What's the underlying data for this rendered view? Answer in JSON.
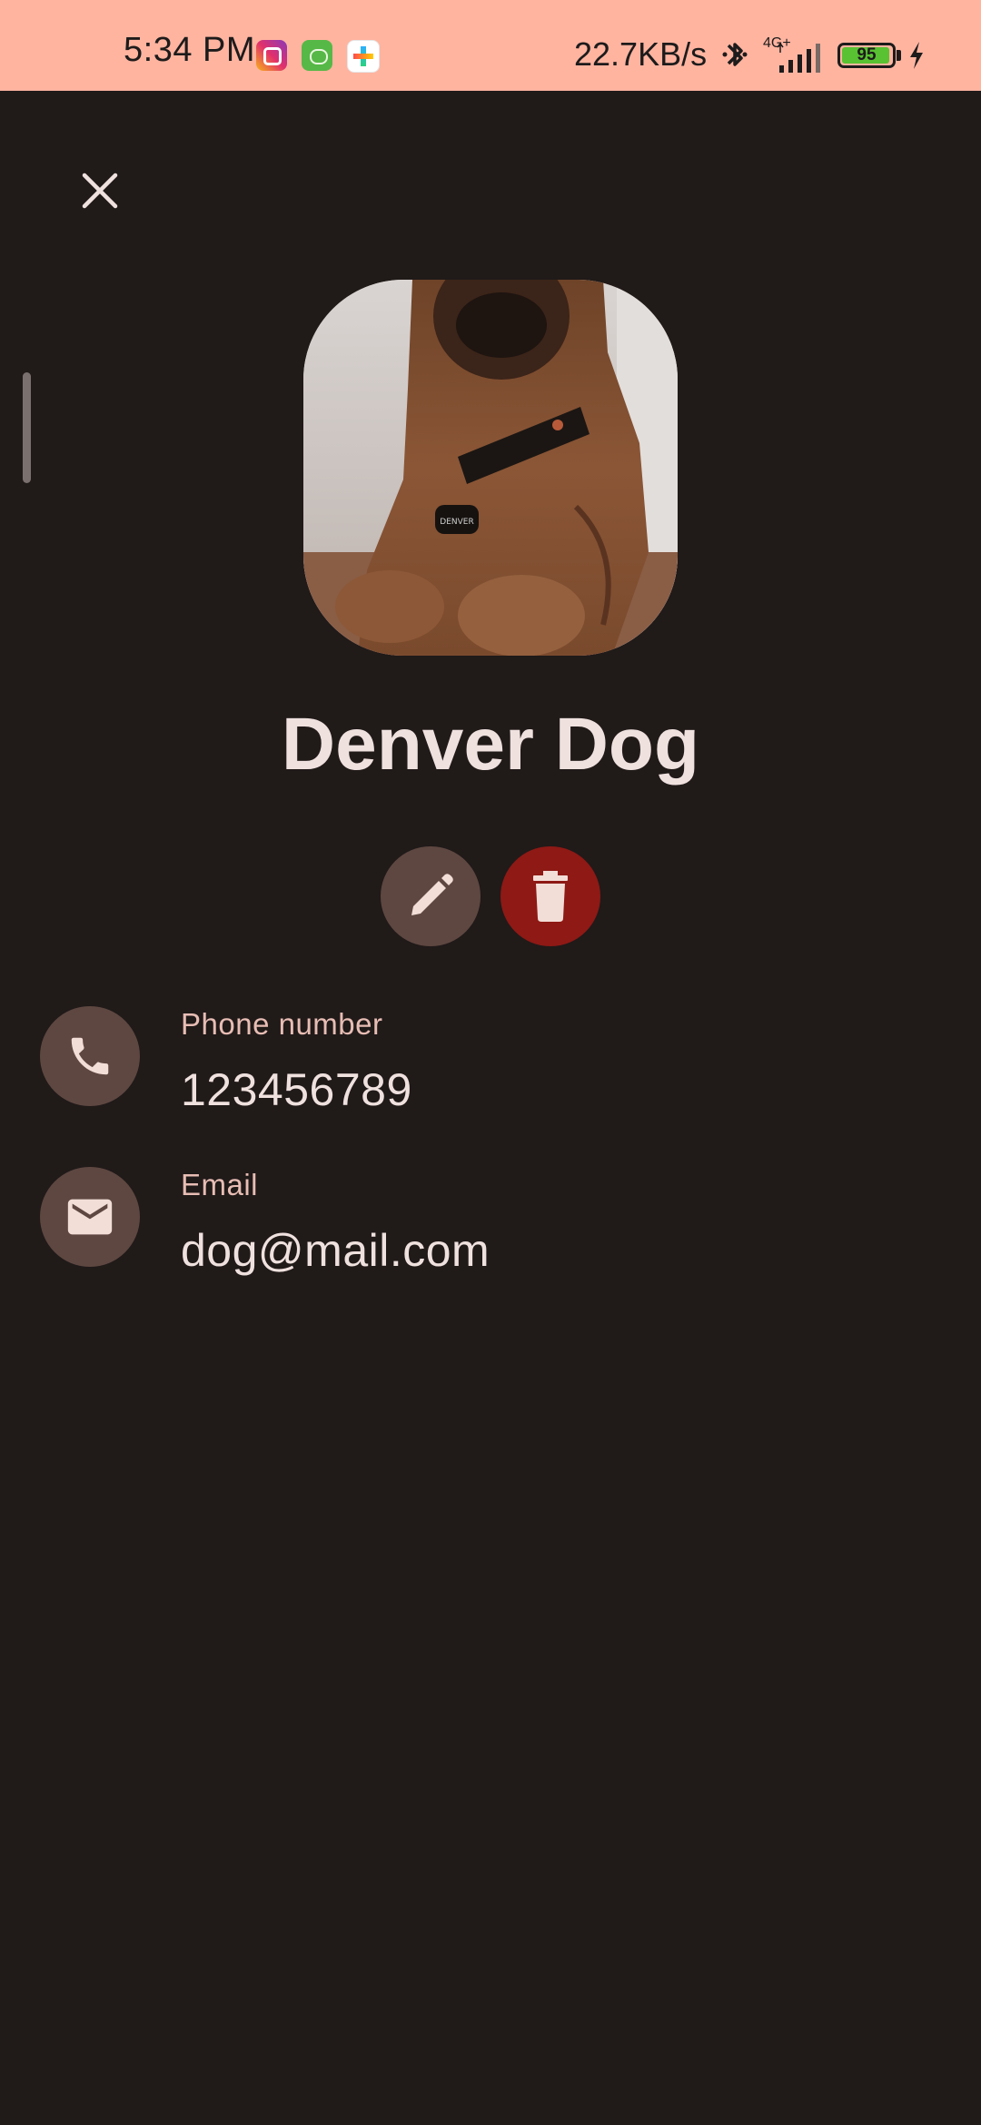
{
  "status_bar": {
    "time": "5:34 PM",
    "net_speed": "22.7KB/s",
    "network_type": "4G+",
    "battery_level": "95",
    "icons": [
      "instagram-icon",
      "frog-app-icon",
      "plus-app-icon",
      "bluetooth-icon",
      "signal-icon",
      "battery-icon",
      "charging-icon"
    ]
  },
  "header": {
    "close_icon": "close-icon"
  },
  "contact": {
    "name": "Denver Dog",
    "avatar_description": "photo of a brown dog with collar tag",
    "avatar_tag_text": "DENVER"
  },
  "actions": {
    "edit_icon": "pencil-icon",
    "delete_icon": "trash-icon"
  },
  "details": {
    "phone": {
      "label": "Phone number",
      "value": "123456789",
      "icon": "phone-icon"
    },
    "email": {
      "label": "Email",
      "value": "dog@mail.com",
      "icon": "mail-icon"
    }
  },
  "colors": {
    "background": "#201a19",
    "status_bar": "#ffb4a0",
    "icon_circle": "#5e4741",
    "delete": "#8e1915",
    "text_primary": "#efe1de",
    "text_label": "#e7bdb4"
  }
}
